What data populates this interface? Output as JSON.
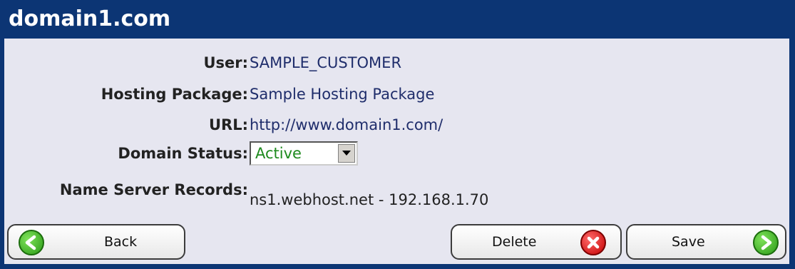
{
  "header": {
    "title": "domain1.com"
  },
  "fields": {
    "user": {
      "label": "User:",
      "value": "SAMPLE_CUSTOMER"
    },
    "hosting_package": {
      "label": "Hosting Package:",
      "value": "Sample Hosting Package"
    },
    "url": {
      "label": "URL:",
      "value": "http://www.domain1.com/"
    },
    "domain_status": {
      "label": "Domain Status:",
      "selected": "Active"
    },
    "name_server_records": {
      "label": "Name Server Records:",
      "value": "ns1.webhost.net - 192.168.1.70"
    }
  },
  "buttons": {
    "back": {
      "label": "Back",
      "icon": "arrow-left-icon"
    },
    "delete": {
      "label": "Delete",
      "icon": "close-icon"
    },
    "save": {
      "label": "Save",
      "icon": "arrow-right-icon"
    }
  },
  "colors": {
    "header_bg": "#0c3574",
    "content_bg": "#e6e6f0",
    "status_active": "#1e8a1e"
  }
}
